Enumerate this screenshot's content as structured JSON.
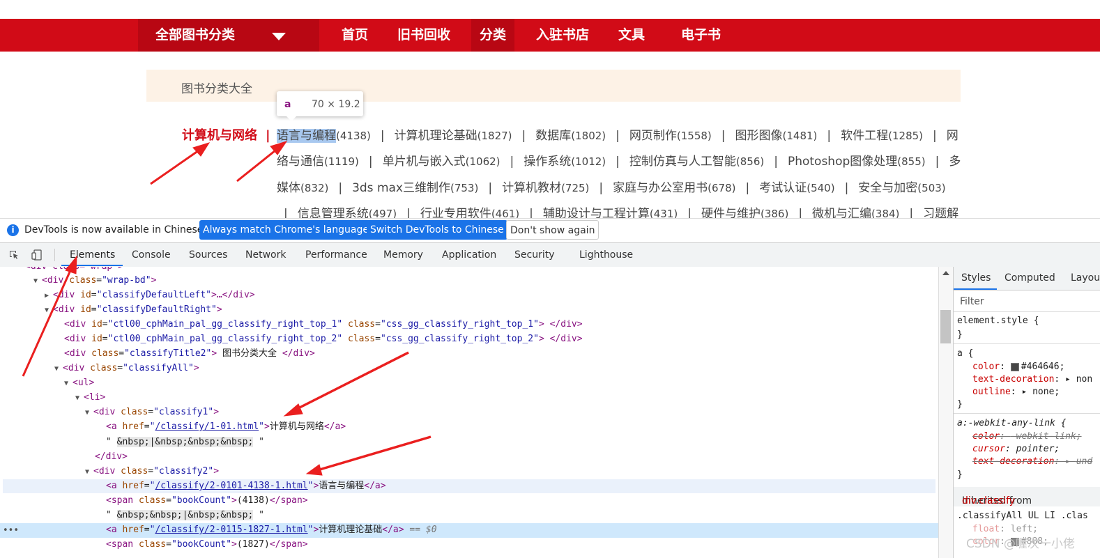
{
  "nav": {
    "all_categories": "全部图书分类",
    "items": [
      "首页",
      "旧书回收",
      "分类",
      "入驻书店",
      "文具",
      "电子书"
    ]
  },
  "section_title": "图书分类大全",
  "tooltip": {
    "tag": "a",
    "size": "70 × 19.2"
  },
  "category_main": "计算机与网络",
  "separator": "|",
  "rows": [
    [
      {
        "name": "语言与编程",
        "count": "(4138)"
      },
      {
        "name": "计算机理论基础",
        "count": "(1827)"
      },
      {
        "name": "数据库",
        "count": "(1802)"
      },
      {
        "name": "网页制作",
        "count": "(1558)"
      },
      {
        "name": "图形图像",
        "count": "(1481)"
      },
      {
        "name": "软件工程",
        "count": "(1285)"
      },
      {
        "name": "网",
        "count": ""
      }
    ],
    [
      {
        "name": "络与通信",
        "count": "(1119)"
      },
      {
        "name": "单片机与嵌入式",
        "count": "(1062)"
      },
      {
        "name": "操作系统",
        "count": "(1012)"
      },
      {
        "name": "控制仿真与人工智能",
        "count": "(856)"
      },
      {
        "name": "Photoshop图像处理",
        "count": "(855)"
      },
      {
        "name": "多",
        "count": ""
      }
    ],
    [
      {
        "name": "媒体",
        "count": "(832)"
      },
      {
        "name": "3ds max三维制作",
        "count": "(753)"
      },
      {
        "name": "计算机教材",
        "count": "(725)"
      },
      {
        "name": "家庭与办公室用书",
        "count": "(678)"
      },
      {
        "name": "考试认证",
        "count": "(540)"
      },
      {
        "name": "安全与加密",
        "count": "(503)"
      }
    ],
    [
      {
        "name": "信息管理系统",
        "count": "(497)"
      },
      {
        "name": "行业专用软件",
        "count": "(461)"
      },
      {
        "name": "辅助设计与工程计算",
        "count": "(431)"
      },
      {
        "name": "硬件与维护",
        "count": "(386)"
      },
      {
        "name": "微机与汇编",
        "count": "(384)"
      },
      {
        "name": "习题解",
        "count": ""
      }
    ]
  ],
  "devtools": {
    "info_icon": "i",
    "info_message": "DevTools is now available in Chinese!",
    "btn_match": "Always match Chrome's language",
    "btn_switch": "Switch DevTools to Chinese",
    "btn_dismiss": "Don't show again",
    "tabs": [
      "Elements",
      "Console",
      "Sources",
      "Network",
      "Performance",
      "Memory",
      "Application",
      "Security",
      "Lighthouse"
    ],
    "styles_tabs": [
      "Styles",
      "Computed",
      "Layou"
    ],
    "filter_placeholder": "Filter",
    "dom": {
      "l0": "<div class=\"wrap\">",
      "wrapbd_tag": "div",
      "wrapbd_attr": "class",
      "wrapbd_val": "\"wrap-bd\"",
      "left_id": "\"classifyDefaultLeft\"",
      "left_tail": ">…</div>",
      "right_id": "\"classifyDefaultRight\"",
      "top1_id": "\"ctl00_cphMain_pal_gg_classify_right_top_1\"",
      "top1_class": "\"css_gg_classify_right_top_1\"",
      "top2_id": "\"ctl00_cphMain_pal_gg_classify_right_top_2\"",
      "top2_class": "\"css_gg_classify_right_top_2\"",
      "title2_class": "\"classifyTitle2\"",
      "title2_text": " 图书分类大全 ",
      "all_class": "\"classifyAll\"",
      "ul": "<ul>",
      "li": "<li>",
      "c1_class": "\"classify1\"",
      "c1_href": "/classify/1-01.html",
      "c1_text": "计算机与网络",
      "ent1": "&nbsp;|&nbsp;&nbsp;&nbsp;",
      "div_close": "</div>",
      "c2_class": "\"classify2\"",
      "c2_href": "/classify/2-0101-4138-1.html",
      "c2_text": "语言与编程",
      "bc_class": "\"bookCount\"",
      "bc1": "(4138)",
      "ent2": "&nbsp;&nbsp;|&nbsp;&nbsp;",
      "c3_href": "/classify/2-0115-1827-1.html",
      "c3_text": "计算机理论基础",
      "sel_marker": "== $0",
      "bc2": "(1827)"
    },
    "styles": {
      "element_style": "element.style {",
      "a_sel": "a {",
      "color_val": "#464646;",
      "td_val": "non",
      "outline_val": "none;",
      "any_link": "a:-webkit-any-link {",
      "al_color": "-webkit-link;",
      "al_cursor": "pointer;",
      "al_td": "und",
      "inherited_label": "Inherited from",
      "inherited_from": "div.classify",
      "classify_sel": ".classifyAll UL LI .clas",
      "float_val": "left;",
      "color2_val": "#888;"
    },
    "colors": {
      "accent": "#1a73e8",
      "text_swatch": "#464646",
      "swatch2": "#888888"
    }
  },
  "watermark": "CSDN @喔次一小佬"
}
